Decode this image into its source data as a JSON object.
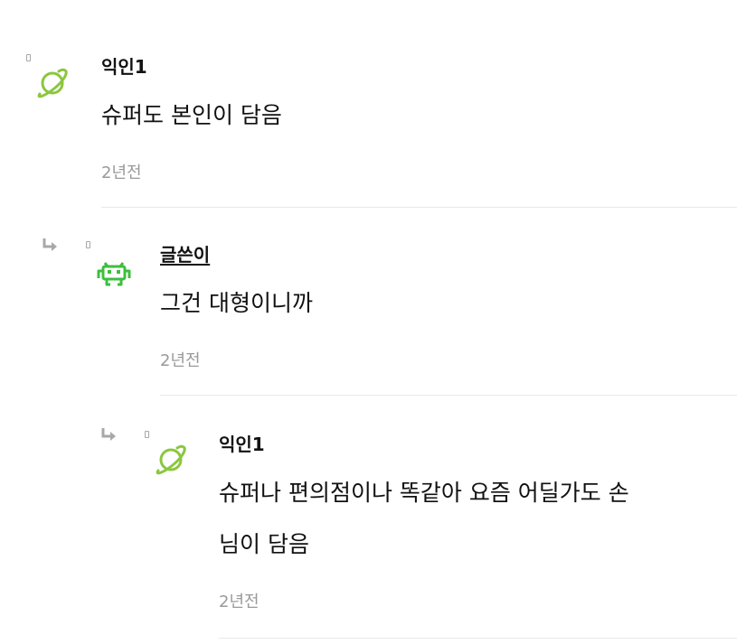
{
  "comments": [
    {
      "author": "익인1",
      "text": "슈퍼도 본인이 담음",
      "time": "2년전",
      "avatar_icon": "planet-icon",
      "is_reply": false
    },
    {
      "author": "글쓴이",
      "text": "그건 대형이니까",
      "time": "2년전",
      "avatar_icon": "space-invader-icon",
      "is_reply": true
    },
    {
      "author": "익인1",
      "text_lines": [
        "슈퍼나 편의점이나 똑같아 요즘 어딜가도 손",
        "님이 담음"
      ],
      "time": "2년전",
      "avatar_icon": "planet-icon",
      "is_reply": true
    }
  ],
  "colors": {
    "planet": "#8cc63f",
    "invader": "#3dbf3d",
    "timestamp": "#9a9a9a",
    "divider": "#e8e8e8"
  }
}
